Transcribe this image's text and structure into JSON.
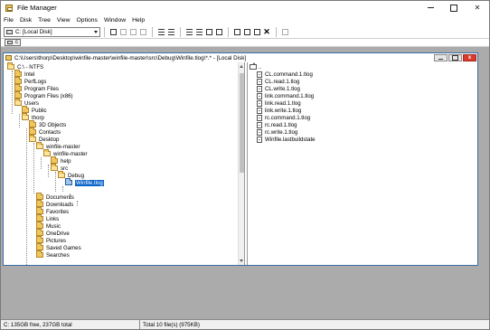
{
  "window": {
    "title": "File Manager",
    "close_glyph": "✕"
  },
  "menu": [
    "File",
    "Disk",
    "Tree",
    "View",
    "Options",
    "Window",
    "Help"
  ],
  "toolbar": {
    "drive_select_value": "C: [Local Disk]"
  },
  "drivebar": {
    "drive_label": "c"
  },
  "child": {
    "title": "C:\\Users\\thorp\\Desktop\\winfile-master\\winfile-master\\src\\Debug\\Winfile.tlog\\*.* - [Local Disk]",
    "close_glyph": "x"
  },
  "tree": {
    "nodes": [
      {
        "label": "C:\\ - NTFS"
      },
      {
        "label": "Intel"
      },
      {
        "label": "PerfLogs"
      },
      {
        "label": "Program Files"
      },
      {
        "label": "Program Files (x86)"
      },
      {
        "label": "Users"
      },
      {
        "label": "Public"
      },
      {
        "label": "thorp"
      },
      {
        "label": "3D Objects"
      },
      {
        "label": "Contacts"
      },
      {
        "label": "Desktop"
      },
      {
        "label": "winfile-master"
      },
      {
        "label": "winfile-master"
      },
      {
        "label": "help"
      },
      {
        "label": "src"
      },
      {
        "label": "Debug"
      },
      {
        "label": "Winfile.tlog"
      },
      {
        "label": "Documents"
      },
      {
        "label": "Downloads"
      },
      {
        "label": "Favorites"
      },
      {
        "label": "Links"
      },
      {
        "label": "Music"
      },
      {
        "label": "OneDrive"
      },
      {
        "label": "Pictures"
      },
      {
        "label": "Saved Games"
      },
      {
        "label": "Searches"
      }
    ]
  },
  "files": {
    "up_label": "..",
    "items": [
      "CL.command.1.tlog",
      "CL.read.1.tlog",
      "CL.write.1.tlog",
      "link.command.1.tlog",
      "link.read.1.tlog",
      "link.write.1.tlog",
      "rc.command.1.tlog",
      "rc.read.1.tlog",
      "rc.write.1.tlog",
      "Winfile.lastbuildstate"
    ]
  },
  "status": {
    "left": "C: 135GB free,  237GB total",
    "right": "Total 10 file(s) (975KB)"
  }
}
